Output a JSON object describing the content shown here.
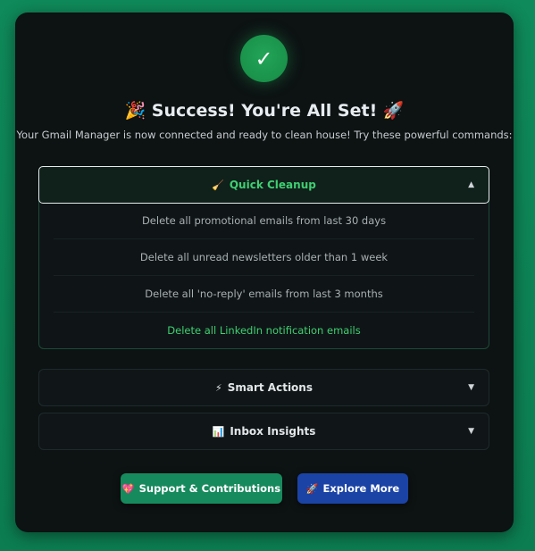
{
  "header": {
    "check_glyph": "✓",
    "title_emoji_left": "🎉",
    "title": "Success! You're All Set!",
    "title_emoji_right": "🚀",
    "subtitle": "Your Gmail Manager is now connected and ready to clean house! Try these powerful commands:"
  },
  "sections": [
    {
      "icon": "🧹",
      "icon_name": "broom-icon",
      "title": "Quick Cleanup",
      "expanded": true,
      "chevron": "▲",
      "items": [
        "Delete all promotional emails from last 30 days",
        "Delete all unread newsletters older than 1 week",
        "Delete all 'no-reply' emails from last 3 months",
        "Delete all LinkedIn notification emails"
      ]
    },
    {
      "icon": "⚡",
      "icon_name": "lightning-icon",
      "title": "Smart Actions",
      "expanded": false,
      "chevron": "▼"
    },
    {
      "icon": "📊",
      "icon_name": "bar-chart-icon",
      "title": "Inbox Insights",
      "expanded": false,
      "chevron": "▼"
    }
  ],
  "buttons": {
    "support": {
      "icon": "💖",
      "label": "Support & Contributions"
    },
    "explore": {
      "icon": "🚀",
      "label": "Explore More"
    }
  },
  "colors": {
    "page_background": "#0f8a5a",
    "card_background": "#0d1213",
    "accent_green": "#3fcf72",
    "support_button": "#178a5d",
    "explore_button": "#1b43a6"
  }
}
